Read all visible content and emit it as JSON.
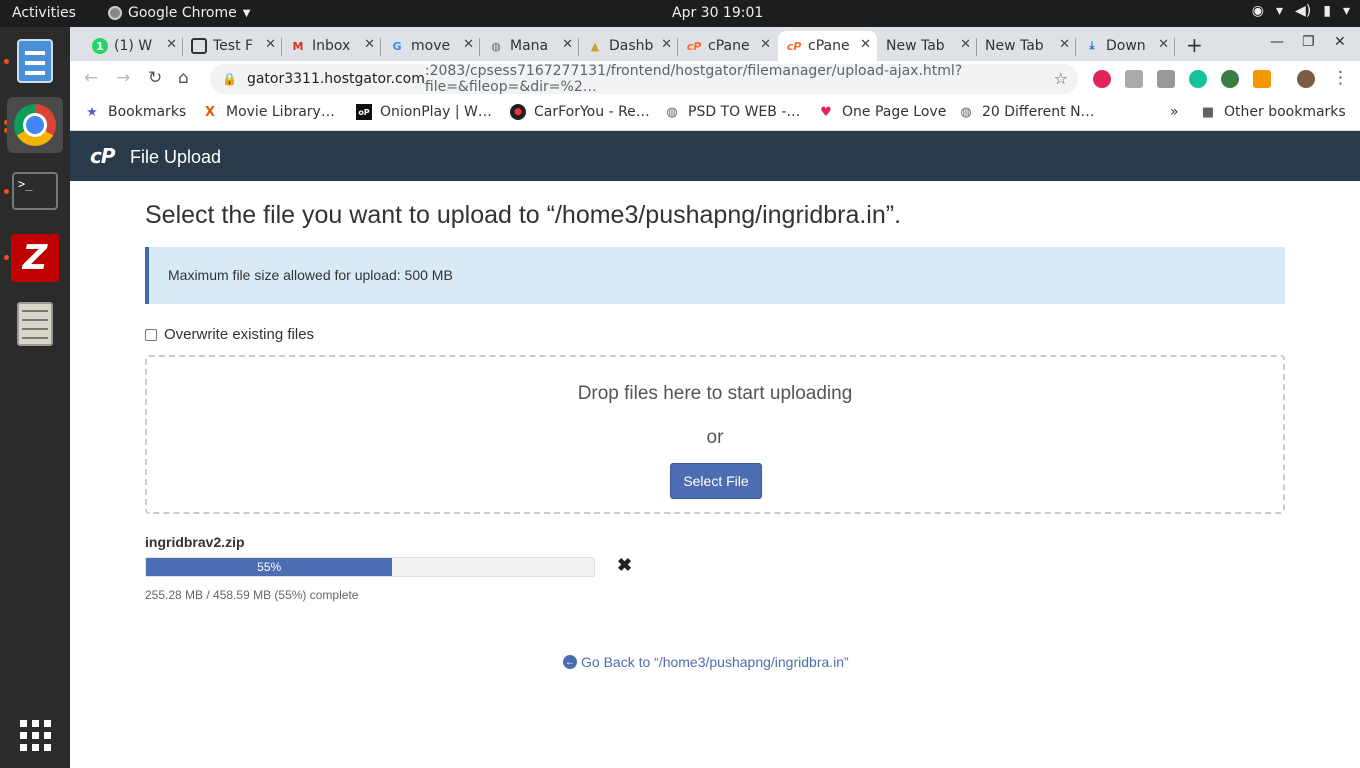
{
  "system": {
    "activities": "Activities",
    "app_name": "Google Chrome",
    "clock": "Apr 30  19:01"
  },
  "browser": {
    "tabs": [
      {
        "label": "(1) W",
        "icon": "whatsapp-icon",
        "color": "#25d366"
      },
      {
        "label": "Test F",
        "icon": "page-icon",
        "color": "#333333"
      },
      {
        "label": "Inbox",
        "icon": "gmail-icon",
        "color": "#d93025"
      },
      {
        "label": "move",
        "icon": "google-icon",
        "color": "#4285f4"
      },
      {
        "label": "Mana",
        "icon": "globe-icon",
        "color": "#5f6368"
      },
      {
        "label": "Dashb",
        "icon": "dashboard-icon",
        "color": "#c9a227"
      },
      {
        "label": "cPane",
        "icon": "cpanel-icon",
        "color": "#ff6c2c"
      },
      {
        "label": "cPane",
        "icon": "cpanel-icon",
        "color": "#ff6c2c"
      },
      {
        "label": "New Tab",
        "icon": "",
        "color": ""
      },
      {
        "label": "New Tab",
        "icon": "",
        "color": ""
      },
      {
        "label": "Down",
        "icon": "download-icon",
        "color": "#1a73e8"
      }
    ],
    "active_tab": 7,
    "url_host": "gator3311.hostgator.com",
    "url_path": ":2083/cpsess7167277131/frontend/hostgator/filemanager/upload-ajax.html?file=&fileop=&dir=%2…",
    "bookmarks": [
      {
        "label": "Bookmarks",
        "icon": "star-icon"
      },
      {
        "label": "Movie Library…",
        "icon": "x-icon"
      },
      {
        "label": "OnionPlay | W…",
        "icon": "onionplay-icon"
      },
      {
        "label": "CarForYou - Re…",
        "icon": "carforyou-icon"
      },
      {
        "label": "PSD TO WEB -…",
        "icon": "globe-icon"
      },
      {
        "label": "One Page Love",
        "icon": "heart-icon"
      },
      {
        "label": "20 Different N…",
        "icon": "globe-icon"
      }
    ],
    "more_bookmarks": "»",
    "other_bookmarks": "Other bookmarks"
  },
  "page": {
    "header_title": "File Upload",
    "logo": "cP",
    "heading": "Select the file you want to upload to “/home3/pushapng/ingridbra.in”.",
    "max_size_info": "Maximum file size allowed for upload: 500 MB",
    "overwrite_label": "Overwrite existing files",
    "overwrite_checked": false,
    "drop_text": "Drop files here to start uploading",
    "or_text": "or",
    "select_button": "Select File",
    "upload": {
      "filename": "ingridbrav2.zip",
      "percent_label": "55%",
      "progress": 0.55,
      "status": "255.28 MB / 458.59 MB (55%) complete"
    },
    "go_back": "Go Back to “/home3/pushapng/ingridbra.in”"
  },
  "colors": {
    "cpanel_header": "#293a4a",
    "accent_blue": "#4c6db1",
    "info_bg": "#d9eaf7"
  }
}
